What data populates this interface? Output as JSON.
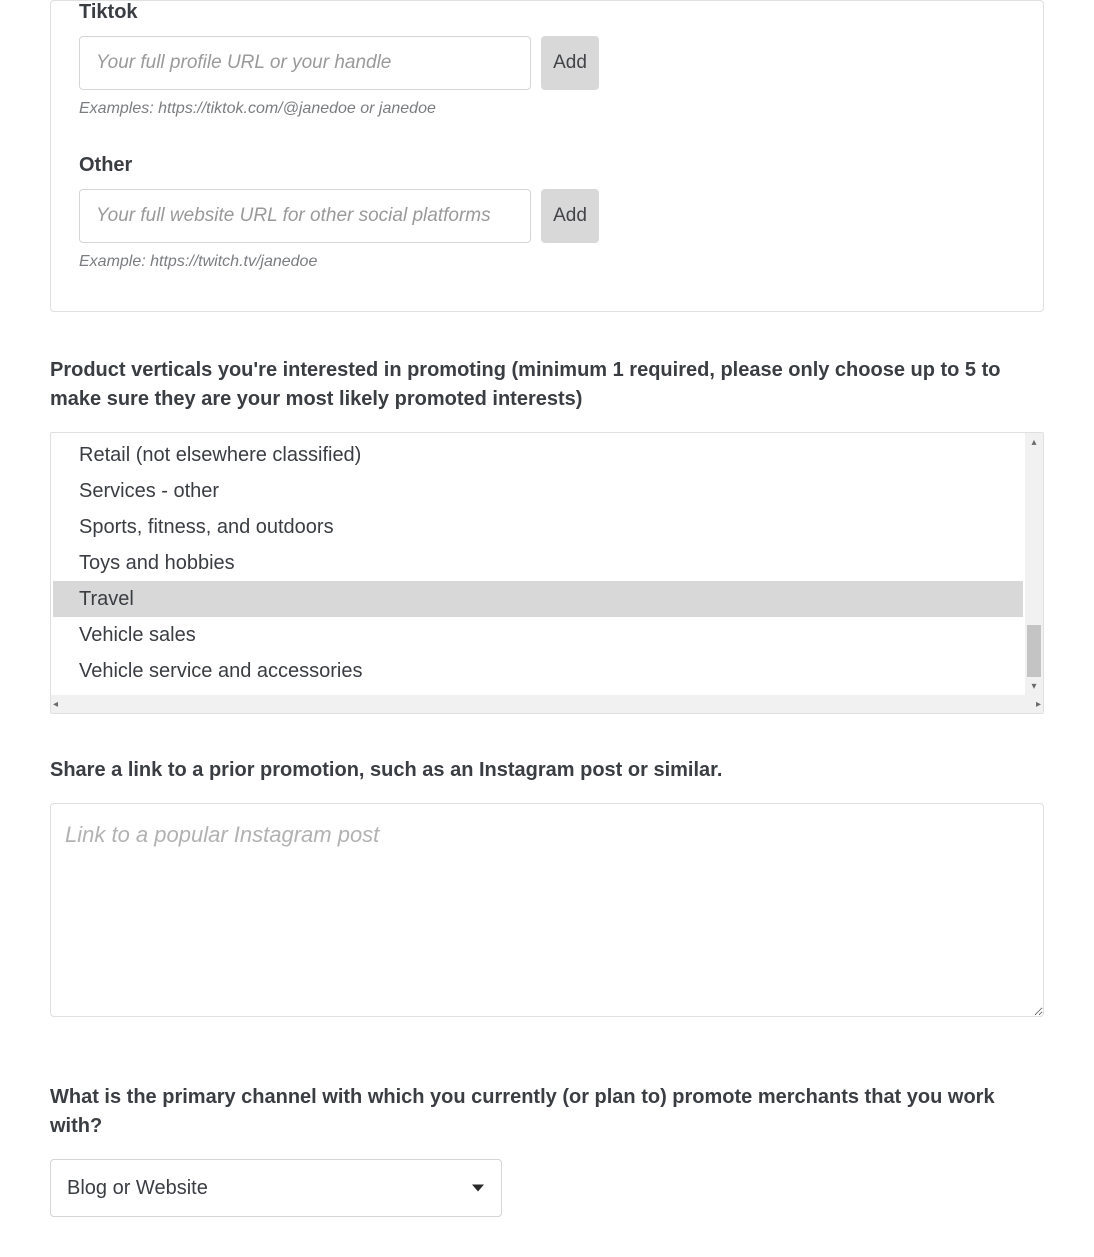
{
  "social": {
    "tiktok": {
      "label": "Tiktok",
      "placeholder": "Your full profile URL or your handle",
      "example": "Examples: https://tiktok.com/@janedoe or janedoe",
      "add_label": "Add"
    },
    "other": {
      "label": "Other",
      "placeholder": "Your full website URL for other social platforms",
      "example": "Example: https://twitch.tv/janedoe",
      "add_label": "Add"
    }
  },
  "verticals": {
    "question": "Product verticals you're interested in promoting (minimum 1 required, please only choose up to 5 to make sure they are your most likely promoted interests)",
    "items": [
      {
        "label": "Retail (not elsewhere classified)",
        "selected": false
      },
      {
        "label": "Services - other",
        "selected": false
      },
      {
        "label": "Sports, fitness, and outdoors",
        "selected": false
      },
      {
        "label": "Toys and hobbies",
        "selected": false
      },
      {
        "label": "Travel",
        "selected": true
      },
      {
        "label": "Vehicle sales",
        "selected": false
      },
      {
        "label": "Vehicle service and accessories",
        "selected": false
      }
    ]
  },
  "prior_promo": {
    "question": "Share a link to a prior promotion, such as an Instagram post or similar.",
    "placeholder": "Link to a popular Instagram post"
  },
  "primary_channel": {
    "question": "What is the primary channel with which you currently (or plan to) promote merchants that you work with?",
    "selected": "Blog or Website"
  }
}
